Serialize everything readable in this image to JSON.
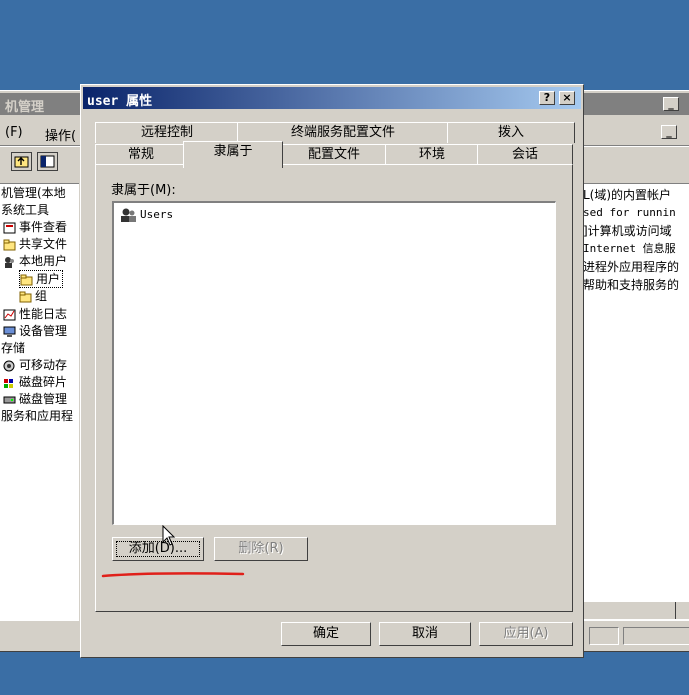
{
  "desktop_bg": "#3a6ea5",
  "mmc": {
    "title": "机管理",
    "menu": {
      "file_label": "(F)",
      "action_label": "操作("
    },
    "tree": [
      {
        "label": "机管理(本地",
        "icon": "computer-icon"
      },
      {
        "label": "系统工具",
        "icon": ""
      },
      {
        "label": "事件查看",
        "icon": "event-viewer-icon"
      },
      {
        "label": "共享文件",
        "icon": "shared-folder-icon"
      },
      {
        "label": "本地用户",
        "icon": "users-icon"
      },
      {
        "label": "用户",
        "icon": "folder-icon"
      },
      {
        "label": "组",
        "icon": "folder-icon"
      },
      {
        "label": "性能日志",
        "icon": "perf-icon"
      },
      {
        "label": "设备管理",
        "icon": "device-icon"
      },
      {
        "label": "存储",
        "icon": ""
      },
      {
        "label": "可移动存",
        "icon": "removable-icon"
      },
      {
        "label": "磁盘碎片",
        "icon": "defrag-icon"
      },
      {
        "label": "磁盘管理",
        "icon": "disk-icon"
      },
      {
        "label": "服务和应用程",
        "icon": ""
      }
    ],
    "descriptions": [
      "L(域)的内置帐户",
      "sed for runnin",
      "]计算机或访问域",
      "Internet 信息服",
      "进程外应用程序的",
      "帮助和支持服务的"
    ]
  },
  "dialog": {
    "title": "user 属性",
    "help_label": "?",
    "close_label": "×",
    "tabs_row1": [
      "远程控制",
      "终端服务配置文件",
      "拨入"
    ],
    "tabs_row2": [
      "常规",
      "隶属于",
      "配置文件",
      "环境",
      "会话"
    ],
    "member_of_label": "隶属于(M):",
    "groups": [
      "Users"
    ],
    "add_button": "添加(D)...",
    "remove_button": "删除(R)",
    "ok_button": "确定",
    "cancel_button": "取消",
    "apply_button": "应用(A)",
    "annotation_color": "#e0201a"
  }
}
